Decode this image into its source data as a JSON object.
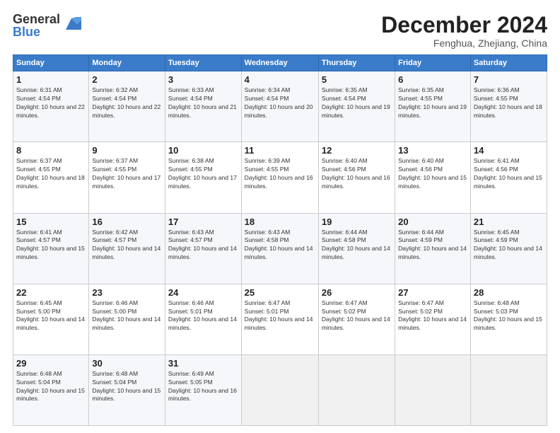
{
  "logo": {
    "general": "General",
    "blue": "Blue"
  },
  "title": "December 2024",
  "subtitle": "Fenghua, Zhejiang, China",
  "days_of_week": [
    "Sunday",
    "Monday",
    "Tuesday",
    "Wednesday",
    "Thursday",
    "Friday",
    "Saturday"
  ],
  "weeks": [
    [
      {
        "day": "1",
        "sunrise": "6:31 AM",
        "sunset": "4:54 PM",
        "daylight": "10 hours and 22 minutes."
      },
      {
        "day": "2",
        "sunrise": "6:32 AM",
        "sunset": "4:54 PM",
        "daylight": "10 hours and 22 minutes."
      },
      {
        "day": "3",
        "sunrise": "6:33 AM",
        "sunset": "4:54 PM",
        "daylight": "10 hours and 21 minutes."
      },
      {
        "day": "4",
        "sunrise": "6:34 AM",
        "sunset": "4:54 PM",
        "daylight": "10 hours and 20 minutes."
      },
      {
        "day": "5",
        "sunrise": "6:35 AM",
        "sunset": "4:54 PM",
        "daylight": "10 hours and 19 minutes."
      },
      {
        "day": "6",
        "sunrise": "6:35 AM",
        "sunset": "4:55 PM",
        "daylight": "10 hours and 19 minutes."
      },
      {
        "day": "7",
        "sunrise": "6:36 AM",
        "sunset": "4:55 PM",
        "daylight": "10 hours and 18 minutes."
      }
    ],
    [
      {
        "day": "8",
        "sunrise": "6:37 AM",
        "sunset": "4:55 PM",
        "daylight": "10 hours and 18 minutes."
      },
      {
        "day": "9",
        "sunrise": "6:37 AM",
        "sunset": "4:55 PM",
        "daylight": "10 hours and 17 minutes."
      },
      {
        "day": "10",
        "sunrise": "6:38 AM",
        "sunset": "4:55 PM",
        "daylight": "10 hours and 17 minutes."
      },
      {
        "day": "11",
        "sunrise": "6:39 AM",
        "sunset": "4:55 PM",
        "daylight": "10 hours and 16 minutes."
      },
      {
        "day": "12",
        "sunrise": "6:40 AM",
        "sunset": "4:56 PM",
        "daylight": "10 hours and 16 minutes."
      },
      {
        "day": "13",
        "sunrise": "6:40 AM",
        "sunset": "4:56 PM",
        "daylight": "10 hours and 15 minutes."
      },
      {
        "day": "14",
        "sunrise": "6:41 AM",
        "sunset": "4:56 PM",
        "daylight": "10 hours and 15 minutes."
      }
    ],
    [
      {
        "day": "15",
        "sunrise": "6:41 AM",
        "sunset": "4:57 PM",
        "daylight": "10 hours and 15 minutes."
      },
      {
        "day": "16",
        "sunrise": "6:42 AM",
        "sunset": "4:57 PM",
        "daylight": "10 hours and 14 minutes."
      },
      {
        "day": "17",
        "sunrise": "6:43 AM",
        "sunset": "4:57 PM",
        "daylight": "10 hours and 14 minutes."
      },
      {
        "day": "18",
        "sunrise": "6:43 AM",
        "sunset": "4:58 PM",
        "daylight": "10 hours and 14 minutes."
      },
      {
        "day": "19",
        "sunrise": "6:44 AM",
        "sunset": "4:58 PM",
        "daylight": "10 hours and 14 minutes."
      },
      {
        "day": "20",
        "sunrise": "6:44 AM",
        "sunset": "4:59 PM",
        "daylight": "10 hours and 14 minutes."
      },
      {
        "day": "21",
        "sunrise": "6:45 AM",
        "sunset": "4:59 PM",
        "daylight": "10 hours and 14 minutes."
      }
    ],
    [
      {
        "day": "22",
        "sunrise": "6:45 AM",
        "sunset": "5:00 PM",
        "daylight": "10 hours and 14 minutes."
      },
      {
        "day": "23",
        "sunrise": "6:46 AM",
        "sunset": "5:00 PM",
        "daylight": "10 hours and 14 minutes."
      },
      {
        "day": "24",
        "sunrise": "6:46 AM",
        "sunset": "5:01 PM",
        "daylight": "10 hours and 14 minutes."
      },
      {
        "day": "25",
        "sunrise": "6:47 AM",
        "sunset": "5:01 PM",
        "daylight": "10 hours and 14 minutes."
      },
      {
        "day": "26",
        "sunrise": "6:47 AM",
        "sunset": "5:02 PM",
        "daylight": "10 hours and 14 minutes."
      },
      {
        "day": "27",
        "sunrise": "6:47 AM",
        "sunset": "5:02 PM",
        "daylight": "10 hours and 14 minutes."
      },
      {
        "day": "28",
        "sunrise": "6:48 AM",
        "sunset": "5:03 PM",
        "daylight": "10 hours and 15 minutes."
      }
    ],
    [
      {
        "day": "29",
        "sunrise": "6:48 AM",
        "sunset": "5:04 PM",
        "daylight": "10 hours and 15 minutes."
      },
      {
        "day": "30",
        "sunrise": "6:48 AM",
        "sunset": "5:04 PM",
        "daylight": "10 hours and 15 minutes."
      },
      {
        "day": "31",
        "sunrise": "6:49 AM",
        "sunset": "5:05 PM",
        "daylight": "10 hours and 16 minutes."
      },
      null,
      null,
      null,
      null
    ]
  ]
}
